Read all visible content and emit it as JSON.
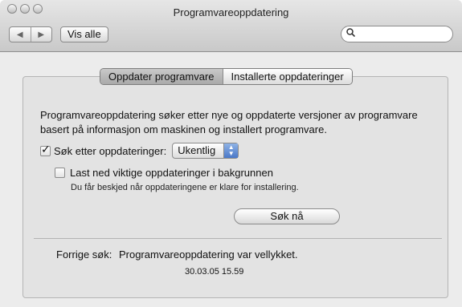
{
  "window": {
    "title": "Programvareoppdatering"
  },
  "toolbar": {
    "show_all_label": "Vis alle",
    "back_glyph": "◀",
    "forward_glyph": "▶",
    "search_placeholder": "",
    "search_icon": "magnifier-icon"
  },
  "tabs": [
    {
      "label": "Oppdater programvare",
      "active": true
    },
    {
      "label": "Installerte oppdateringer",
      "active": false
    }
  ],
  "main": {
    "description": "Programvareoppdatering søker etter nye og oppdaterte versjoner av programvare basert på informasjon om maskinen og installert programvare.",
    "check_updates": {
      "label": "Søk etter oppdateringer:",
      "checked": true
    },
    "frequency": {
      "selected": "Ukentlig"
    },
    "download_background": {
      "label": "Last ned viktige oppdateringer i bakgrunnen",
      "checked": false
    },
    "download_note": "Du får beskjed når oppdateringene er klare for installering.",
    "search_now_label": "Søk nå",
    "last_search_prefix": "Forrige søk:",
    "last_search_status": "Programvareoppdatering var vellykket.",
    "last_search_date": "30.03.05 15.59"
  },
  "colors": {
    "accent": "#4a78c8"
  }
}
